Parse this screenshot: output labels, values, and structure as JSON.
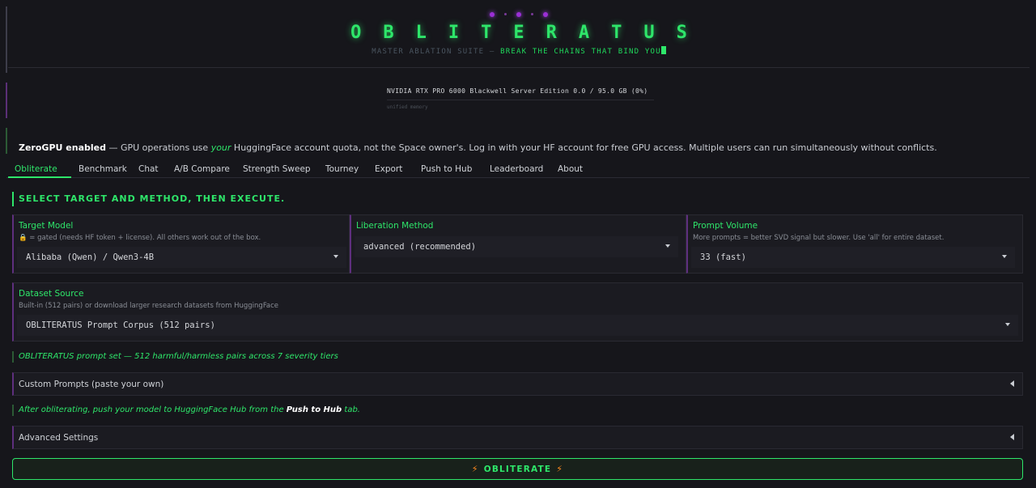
{
  "header": {
    "title": "OBLITERATUS",
    "subtitle_dim": "MASTER ABLATION SUITE — ",
    "subtitle_bright": "BREAK THE CHAINS THAT BIND YOU"
  },
  "gpu": {
    "line": "NVIDIA RTX PRO 6000 Blackwell Server Edition  0.0 / 95.0 GB (0%)",
    "sub": "unified memory"
  },
  "zerogpu": {
    "bold": "ZeroGPU enabled",
    "pre": " — GPU operations use ",
    "italic": "your",
    "post": " HuggingFace account quota, not the Space owner's. Log in with your HF account for free GPU access. Multiple users can run simultaneously without conflicts."
  },
  "tabs": [
    "Obliterate",
    "Benchmark",
    "Chat",
    "A/B Compare",
    "Strength Sweep",
    "Tourney",
    "Export",
    "Push to Hub",
    "Leaderboard",
    "About"
  ],
  "section_heading": "SELECT TARGET AND METHOD, THEN EXECUTE.",
  "target_model": {
    "label": "Target Model",
    "info": "🔒 = gated (needs HF token + license). All others work out of the box.",
    "value": "Alibaba (Qwen) / Qwen3-4B"
  },
  "liberation_method": {
    "label": "Liberation Method",
    "value": "advanced (recommended)"
  },
  "prompt_volume": {
    "label": "Prompt Volume",
    "info": "More prompts = better SVD signal but slower. Use 'all' for entire dataset.",
    "value": "33 (fast)"
  },
  "dataset_source": {
    "label": "Dataset Source",
    "info": "Built-in (512 pairs) or download larger research datasets from HuggingFace",
    "value": "OBLITERATUS Prompt Corpus (512 pairs)"
  },
  "dataset_note": "OBLITERATUS prompt set — 512 harmful/harmless pairs across 7 severity tiers",
  "custom_prompts_label": "Custom Prompts (paste your own)",
  "push_note": {
    "pre": "After obliterating, push your model to HuggingFace Hub from the ",
    "bold": "Push to Hub",
    "post": " tab."
  },
  "advanced_settings_label": "Advanced Settings",
  "obliterate_button": "OBLITERATE",
  "colors": {
    "accent_green": "#2ee66a",
    "accent_purple": "#9b2fd6",
    "bolt_orange": "#ff8a1e",
    "background": "#16161b"
  }
}
